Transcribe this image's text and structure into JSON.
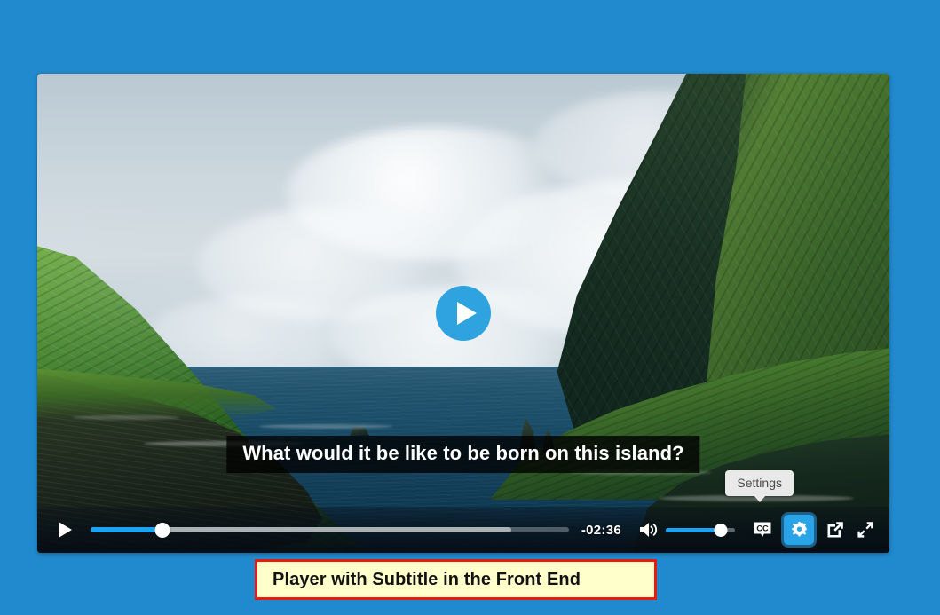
{
  "page": {
    "background_color": "#2189ce",
    "accent_color": "#1fa2f0"
  },
  "player": {
    "play_overlay": {
      "icon": "play-triangle-icon",
      "label": "Play"
    },
    "subtitle_cue": "What would it be like to be born on this island?",
    "tooltip": {
      "label": "Settings",
      "background_color": "#e9e9e9"
    },
    "controls": {
      "play_button_label": "Play",
      "play_icon": "play-triangle-icon",
      "progress": {
        "played_percent": 15,
        "buffered_percent": 88,
        "fill_color": "#1fa2f0",
        "handle_color": "#ffffff"
      },
      "time_remaining": "-02:36",
      "volume": {
        "icon": "speaker-waves-icon",
        "level_percent": 80,
        "fill_color": "#1fa2f0"
      },
      "buttons": [
        {
          "name": "captions",
          "icon": "cc-bubble-icon",
          "label": "CC",
          "active": false
        },
        {
          "name": "settings",
          "icon": "gear-icon",
          "label": "Settings",
          "active": true
        },
        {
          "name": "popout",
          "icon": "open-in-new-icon",
          "label": "Pop out",
          "active": false
        },
        {
          "name": "fullscreen",
          "icon": "expand-arrows-icon",
          "label": "Fullscreen",
          "active": false
        }
      ],
      "settings_button": {
        "background_color": "#2aa4e8",
        "outline_color": "#1d5f86"
      }
    }
  },
  "annotation": {
    "caption_text": "Player with Subtitle in the Front End",
    "background_color": "#ffffcc",
    "border_color": "#e81b11"
  }
}
